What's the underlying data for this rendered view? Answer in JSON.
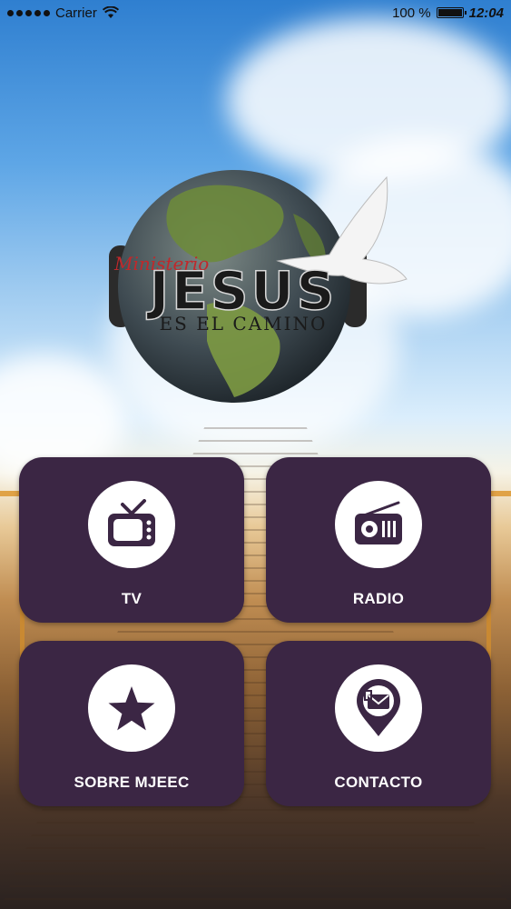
{
  "status_bar": {
    "carrier": "Carrier",
    "battery_percent": "100 %",
    "time": "12:04"
  },
  "logo": {
    "script_text": "Ministerio",
    "title": "JESUS",
    "subtitle": "ES EL CAMINO"
  },
  "menu": [
    {
      "label": "TV",
      "icon": "tv-icon"
    },
    {
      "label": "RADIO",
      "icon": "radio-icon"
    },
    {
      "label": "SOBRE MJEEC",
      "icon": "star-icon"
    },
    {
      "label": "CONTACTO",
      "icon": "contact-mail-pin-icon"
    }
  ],
  "colors": {
    "tile_background": "#3b2644",
    "tile_icon_circle": "#ffffff",
    "tile_label": "#ffffff"
  }
}
